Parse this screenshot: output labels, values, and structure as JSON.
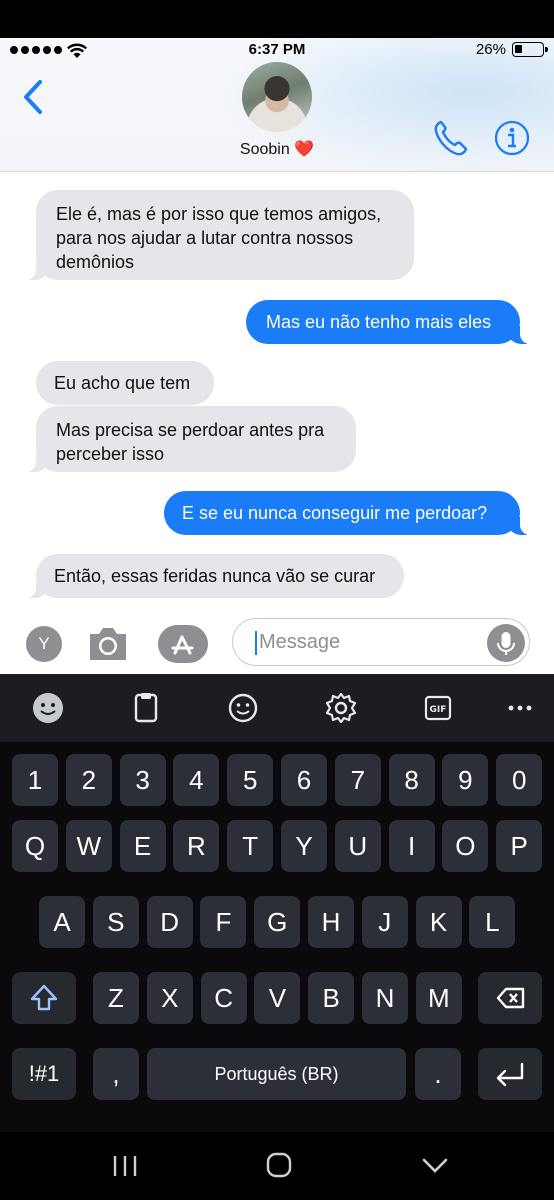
{
  "status_bar": {
    "time": "6:37 PM",
    "battery_percent": "26%",
    "battery_level": 0.26
  },
  "header": {
    "contact_name": "Soobin ❤️",
    "back_icon": "chevron-left-icon",
    "call_icon": "phone-icon",
    "info_icon": "info-icon"
  },
  "messages": [
    {
      "from": "contact",
      "lines": [
        "Ele é, mas é por isso que temos amigos,",
        "para nos ajudar a lutar contra nossos",
        "demônios"
      ]
    },
    {
      "from": "me",
      "lines": [
        "Mas eu não tenho mais eles"
      ]
    },
    {
      "from": "contact",
      "lines": [
        "Eu acho que tem"
      ]
    },
    {
      "from": "contact",
      "lines": [
        "Mas precisa se perdoar antes pra",
        "perceber isso"
      ]
    },
    {
      "from": "me",
      "lines": [
        "E se eu nunca conseguir me perdoar?"
      ]
    },
    {
      "from": "contact",
      "lines": [
        "Então, essas feridas nunca vão se curar"
      ]
    }
  ],
  "compose": {
    "apps_letter": "Y",
    "placeholder": "Message"
  },
  "keyboard": {
    "toolbar": [
      "emoji-face-icon",
      "clipboard-icon",
      "smiley-icon",
      "settings-gear-icon",
      "gif-icon",
      "more-icon"
    ],
    "gif_label": "GIF",
    "row_numbers": [
      "1",
      "2",
      "3",
      "4",
      "5",
      "6",
      "7",
      "8",
      "9",
      "0"
    ],
    "row_q": [
      "Q",
      "W",
      "E",
      "R",
      "T",
      "Y",
      "U",
      "I",
      "O",
      "P"
    ],
    "row_a": [
      "A",
      "S",
      "D",
      "F",
      "G",
      "H",
      "J",
      "K",
      "L"
    ],
    "row_z": [
      "Z",
      "X",
      "C",
      "V",
      "B",
      "N",
      "M"
    ],
    "symbols_label": "!#1",
    "comma": ",",
    "space_label": "Português (BR)",
    "period": "."
  },
  "colors": {
    "accent": "#1a7cf7",
    "incoming_bubble": "#e5e5ea",
    "keyboard_bg": "#0a0a0c",
    "key_bg": "#2c2f38"
  }
}
